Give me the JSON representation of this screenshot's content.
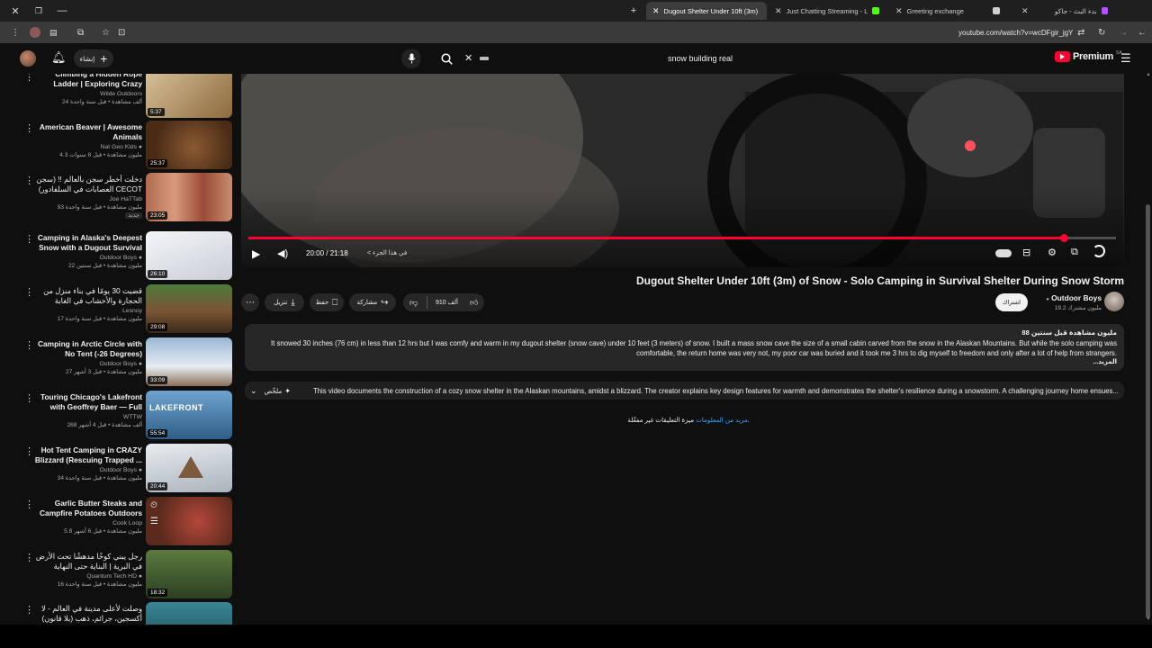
{
  "browser": {
    "tabs": [
      {
        "label": "Dugout Shelter Under 10ft (3m)",
        "color": "#ff0033",
        "active": true
      },
      {
        "label": "Just Chatting Streaming - Live St",
        "color": "#53fc18",
        "active": false
      },
      {
        "label": "Greeting exchange",
        "color": "#cfcfcf",
        "active": false
      },
      {
        "label": "بدء البث - جاكو",
        "color": "#b052ff",
        "active": false
      }
    ],
    "url": "youtube.com/watch?v=wcDFgir_jgY"
  },
  "header": {
    "create_label": "إنشاء",
    "search_value": "snow building real",
    "logo_text": "Premium",
    "logo_region": "SA"
  },
  "recommendations": [
    {
      "title": "Climbing a Hidden Rope Ladder | Exploring Crazy Caves &",
      "channel": "Wilde Outdoors",
      "stats": "24 ألف مشاهدة • قبل سنة واحدة",
      "duration": "5:37",
      "thumb": "#b89560"
    },
    {
      "title": "American Beaver | Awesome Animals",
      "channel": "Nat Geo Kids",
      "stats": "4.3 مليون مشاهدة • قبل 8 سنوات",
      "duration": "25:37",
      "thumb": "#7b4e2a"
    },
    {
      "title": "دخلت أخطر سجن بالعالم !! (سجن العصابات في السلفادور) CECOT",
      "channel": "Joe HaTTab",
      "stats": "93 مليون مشاهدة • قبل سنة واحدة",
      "duration": "23:05",
      "thumb": "#a0523a",
      "badge": "جديد"
    },
    {
      "title": "Camping in Alaska's Deepest Snow with a Dugout Survival ...",
      "channel": "Outdoor Boys",
      "stats": "22 مليون مشاهدة • قبل سنتين",
      "duration": "26:10",
      "thumb": "#e6e9ee"
    },
    {
      "title": "قضيت 30 يومًا في بناء منزل من الحجارة والأخشاب في الغابة",
      "channel": "Lesnoy",
      "stats": "17 مليون مشاهدة • قبل سنة واحدة",
      "duration": "29:08",
      "thumb": "#6b4a2e"
    },
    {
      "title": "Camping in Arctic Circle with No Tent (-26 Degrees)",
      "channel": "Outdoor Boys",
      "stats": "27 مليون مشاهدة • قبل 3 أشهر",
      "duration": "33:09",
      "thumb": "#cfdcea"
    },
    {
      "title": "Touring Chicago's Lakefront with Geoffrey Baer — Full Show",
      "channel": "WTTW",
      "stats": "268 ألف مشاهدة • قبل 4 أشهر",
      "duration": "55:54",
      "thumb": "#3f6e97",
      "overlay": "LAKEFRONT"
    },
    {
      "title": "Hot Tent Camping in CRAZY Blizzard (Rescuing Trapped ...",
      "channel": "Outdoor Boys",
      "stats": "34 مليون مشاهدة • قبل سنة واحدة",
      "duration": "20:44",
      "thumb": "#d4d8dd"
    },
    {
      "title": "Garlic Butter Steaks and Campfire Potatoes Outdoors",
      "channel": "Cook Loop",
      "stats": "5.8 مليون مشاهدة • قبل 6 أشهر",
      "duration": "",
      "thumb": "#8a3b2c"
    },
    {
      "title": "رجل يبني كوخًا مدهشًا تحت الأرض في البرية | البناية حتى النهاية بواسطة ...",
      "channel": "Quantum Tech HD",
      "stats": "16 مليون مشاهدة • قبل سنة واحدة",
      "duration": "18:32",
      "thumb": "#2f4a2a"
    },
    {
      "title": "وصلت لأعلى مدينة في العالم - لا أكسجين، جرائم، ذهب (بلا قانون)",
      "channel": "",
      "stats": "",
      "duration": "",
      "thumb": "#2b6a78",
      "badge": "PE"
    }
  ],
  "player": {
    "time": "20:00 / 21:18",
    "chapter": "< في هذا الجزء"
  },
  "video": {
    "title": "Dugout Shelter Under 10ft (3m) of Snow - Solo Camping in Survival Shelter During Snow Storm",
    "channel": "Outdoor Boys",
    "subscribers": "19.2 مليون مشترك",
    "join_label": "اشتراك",
    "likes": "910 ألف",
    "share_label": "مشاركة",
    "save_label": "حفظ",
    "download_label": "تنزيل",
    "views_line": "88 مليون مشاهدة  قبل سنتين",
    "description": "It snowed 30 inches (76 cm) in less than 12 hrs but I was comfy and warm in my dugout shelter (snow cave) under 10 feet (3 meters) of snow. I built a mass snow cave the size of a small cabin carved from the snow in the Alaskan Mountains. But while the solo camping was comfortable, the return home was very not, my poor car was buried and it took me 3 hrs to dig myself to freedom and only after a lot of help from strangers.",
    "more_label": "...المزيد",
    "summary_label": "ملخّص",
    "summary_text": "This video documents the construction of a cozy snow shelter in the Alaskan mountains, amidst a blizzard. The creator explains key design features for warmth and demonstrates the shelter's resilience during a snowstorm. A challenging journey home ensues...",
    "comments_prefix": "ميزة التعليقات غير مفعّلة.",
    "comments_link": "مزيد من المعلومات"
  }
}
